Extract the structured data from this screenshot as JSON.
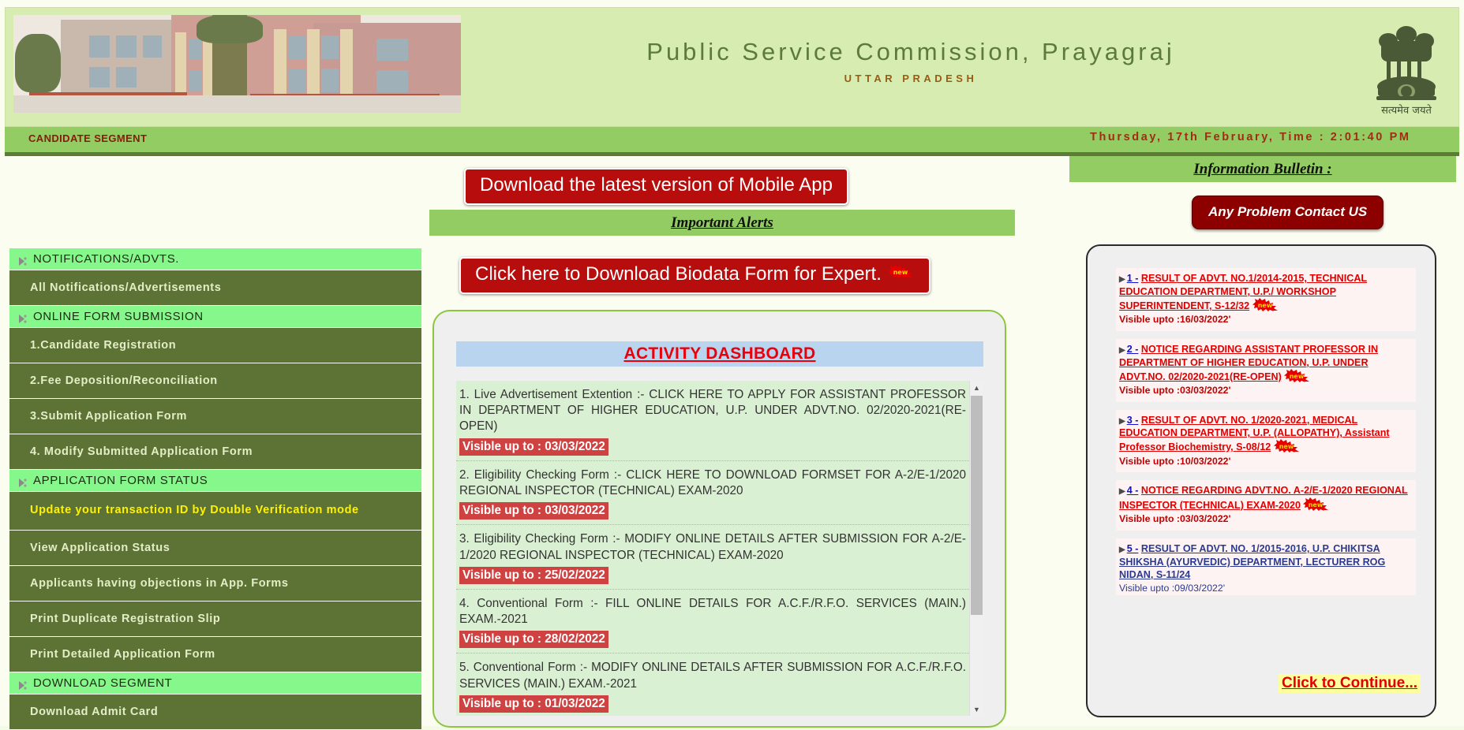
{
  "header": {
    "title": "Public Service Commission, Prayagraj",
    "subtitle": "UTTAR PRADESH",
    "emblem_caption": "सत्यमेव जयते",
    "emblem_name": "ashoka-emblem"
  },
  "candidate_bar": {
    "label": "CANDIDATE SEGMENT",
    "datetime": "Thursday, 17th February, Time : 2:01:40 PM"
  },
  "sidebar": {
    "items": [
      {
        "type": "head",
        "label": "NOTIFICATIONS/ADVTS."
      },
      {
        "type": "item",
        "label": "All Notifications/Advertisements"
      },
      {
        "type": "head",
        "label": "ONLINE FORM SUBMISSION"
      },
      {
        "type": "item",
        "label": "1.Candidate Registration"
      },
      {
        "type": "item",
        "label": "2.Fee Deposition/Reconciliation"
      },
      {
        "type": "item",
        "label": "3.Submit Application Form"
      },
      {
        "type": "item",
        "label": "4. Modify Submitted Application Form"
      },
      {
        "type": "head",
        "label": "APPLICATION FORM STATUS"
      },
      {
        "type": "item",
        "label": "Update your transaction ID by Double Verification mode",
        "highlight": true
      },
      {
        "type": "item",
        "label": "View Application Status"
      },
      {
        "type": "item",
        "label": "Applicants having objections in App. Forms"
      },
      {
        "type": "item",
        "label": "Print Duplicate Registration Slip"
      },
      {
        "type": "item",
        "label": "Print Detailed Application Form"
      },
      {
        "type": "head",
        "label": "DOWNLOAD SEGMENT"
      },
      {
        "type": "item",
        "label": "Download Admit Card"
      }
    ]
  },
  "center": {
    "mobile_app_button": "Download the latest version of Mobile App",
    "alerts_title": "Important Alerts",
    "biodata_button": "Click here to Download Biodata Form for Expert.",
    "dashboard_title": "ACTIVITY DASHBOARD",
    "dashboard_items": [
      {
        "text": "1. Live Advertisement Extention :- CLICK HERE TO APPLY FOR ASSISTANT PROFESSOR IN DEPARTMENT OF HIGHER EDUCATION, U.P. UNDER ADVT.NO. 02/2020-2021(RE-OPEN)",
        "visible": "Visible up to : 03/03/2022"
      },
      {
        "text": "2. Eligibility Checking Form :- CLICK HERE TO DOWNLOAD FORMSET FOR A-2/E-1/2020 REGIONAL INSPECTOR (TECHNICAL) EXAM-2020",
        "visible": "Visible up to : 03/03/2022"
      },
      {
        "text": "3. Eligibility Checking Form :- MODIFY ONLINE DETAILS AFTER SUBMISSION FOR A-2/E-1/2020 REGIONAL INSPECTOR (TECHNICAL) EXAM-2020",
        "visible": "Visible up to : 25/02/2022"
      },
      {
        "text": "4. Conventional Form :- FILL ONLINE DETAILS FOR A.C.F./R.F.O. SERVICES (MAIN.) EXAM.-2021",
        "visible": "Visible up to : 28/02/2022"
      },
      {
        "text": "5. Conventional Form :- MODIFY ONLINE DETAILS AFTER SUBMISSION FOR A.C.F./R.F.O. SERVICES (MAIN.) EXAM.-2021",
        "visible": "Visible up to : 01/03/2022"
      }
    ]
  },
  "right": {
    "bulletin_title": "Information Bulletin :",
    "contact_button": "Any Problem Contact US",
    "continue_link": "Click to Continue...",
    "bulletin_items": [
      {
        "num": "1 -",
        "text": "RESULT OF ADVT. NO.1/2014-2015, TECHNICAL EDUCATION DEPARTMENT, U.P./ WORKSHOP SUPERINTENDENT, S-12/32",
        "visible": "Visible upto :16/03/2022'",
        "is_new": true,
        "style": "red"
      },
      {
        "num": "2 -",
        "text": "NOTICE REGARDING ASSISTANT PROFESSOR IN DEPARTMENT OF HIGHER EDUCATION, U.P. UNDER ADVT.NO. 02/2020-2021(RE-OPEN)",
        "visible": "Visible upto :03/03/2022'",
        "is_new": true,
        "style": "red"
      },
      {
        "num": "3 -",
        "text": "RESULT OF ADVT. NO. 1/2020-2021, MEDICAL EDUCATION DEPARTMENT, U.P. (ALLOPATHY), Assistant Professor Biochemistry, S-08/12",
        "visible": "Visible upto :10/03/2022'",
        "is_new": true,
        "style": "red"
      },
      {
        "num": "4 -",
        "text": "NOTICE REGARDING ADVT.NO. A-2/E-1/2020 REGIONAL INSPECTOR (TECHNICAL) EXAM-2020",
        "visible": "Visible upto :03/03/2022'",
        "is_new": true,
        "style": "red"
      },
      {
        "num": "5 -",
        "text": "RESULT OF ADVT. NO. 1/2015-2016, U.P. CHIKITSA SHIKSHA (AYURVEDIC) DEPARTMENT, LECTURER ROG NIDAN, S-11/24",
        "visible": "Visible upto :09/03/2022'",
        "is_new": false,
        "style": "navy"
      }
    ]
  },
  "colors": {
    "header_bg": "#d6ecb0",
    "bar_green": "#93cc63",
    "sidebar_item": "#5d7336",
    "sidebar_head": "#86f78b",
    "red_button": "#b80d0d",
    "dashboard_title_bg": "#b9d4ef",
    "visible_badge": "#cf4242"
  }
}
